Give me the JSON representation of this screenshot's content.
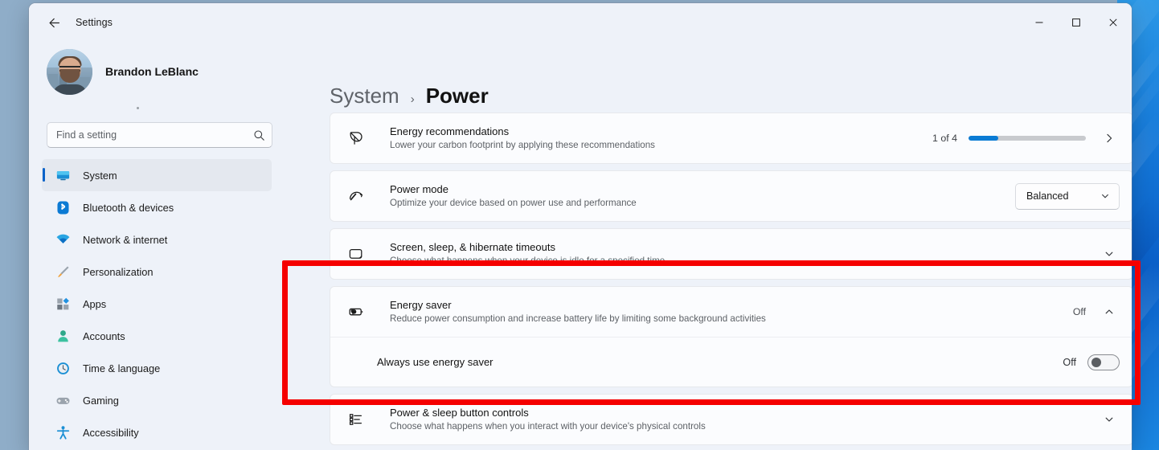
{
  "window": {
    "titlebar_title": "Settings",
    "back_icon": "arrow-left-icon",
    "controls": {
      "minimize": "minimize-icon",
      "maximize": "maximize-icon",
      "close": "close-icon"
    }
  },
  "sidebar": {
    "account_name": "Brandon LeBlanc",
    "search": {
      "placeholder": "Find a setting",
      "value": "",
      "icon": "search-icon"
    },
    "items": [
      {
        "label": "System",
        "icon": "monitor-icon",
        "selected": true
      },
      {
        "label": "Bluetooth & devices",
        "icon": "bluetooth-icon",
        "selected": false
      },
      {
        "label": "Network & internet",
        "icon": "wifi-icon",
        "selected": false
      },
      {
        "label": "Personalization",
        "icon": "paintbrush-icon",
        "selected": false
      },
      {
        "label": "Apps",
        "icon": "apps-icon",
        "selected": false
      },
      {
        "label": "Accounts",
        "icon": "person-icon",
        "selected": false
      },
      {
        "label": "Time & language",
        "icon": "clock-icon",
        "selected": false
      },
      {
        "label": "Gaming",
        "icon": "gamepad-icon",
        "selected": false
      },
      {
        "label": "Accessibility",
        "icon": "accessibility-icon",
        "selected": false
      }
    ]
  },
  "breadcrumb": {
    "parent": "System",
    "separator": "›",
    "current": "Power"
  },
  "cards": {
    "energy_recommendations": {
      "title": "Energy recommendations",
      "subtitle": "Lower your carbon footprint by applying these recommendations",
      "icon": "leaf-icon",
      "progress_label": "1 of 4",
      "progress_percent": 25,
      "progress_color": "#0a7bd4",
      "chevron": "chevron-right-icon"
    },
    "power_mode": {
      "title": "Power mode",
      "subtitle": "Optimize your device based on power use and performance",
      "icon": "gauge-icon",
      "dropdown_value": "Balanced",
      "dropdown_chevron": "chevron-down-icon"
    },
    "timeouts": {
      "title": "Screen, sleep, & hibernate timeouts",
      "subtitle": "Choose what happens when your device is idle for a specified time",
      "icon": "screen-moon-icon",
      "chevron": "chevron-down-icon"
    },
    "energy_saver": {
      "title": "Energy saver",
      "subtitle": "Reduce power consumption and increase battery life by limiting some background activities",
      "icon": "battery-leaf-icon",
      "state_value": "Off",
      "chevron": "chevron-up-icon",
      "sub_setting": {
        "label": "Always use energy saver",
        "toggle_label": "Off",
        "toggle_on": false
      }
    },
    "power_sleep_buttons": {
      "title": "Power & sleep button controls",
      "subtitle": "Choose what happens when you interact with your device's physical controls",
      "icon": "list-settings-icon",
      "chevron": "chevron-down-icon"
    }
  },
  "annotation": {
    "highlight_color": "#f50000",
    "target": "energy-saver-card"
  }
}
